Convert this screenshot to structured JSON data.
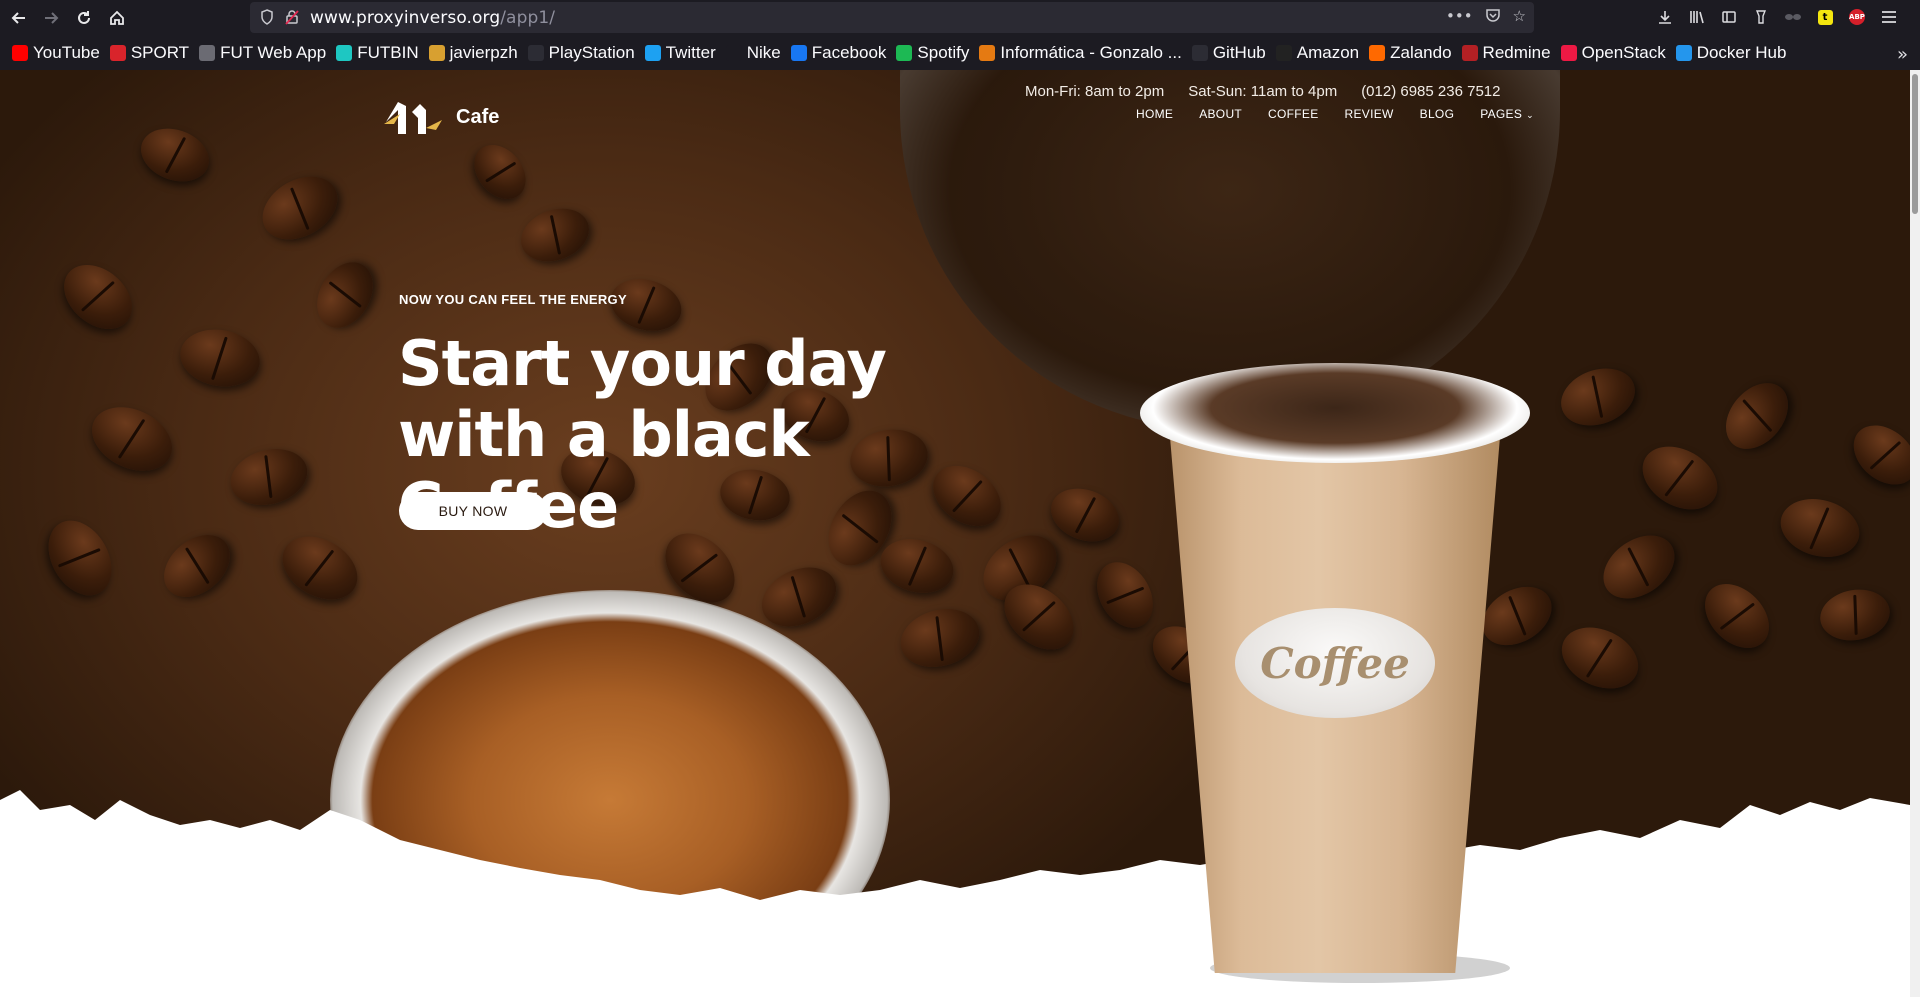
{
  "browser": {
    "url_host": "www.proxyinverso.org",
    "url_path": "/app1/",
    "bookmarks": [
      {
        "label": "YouTube",
        "color": "#ff0000"
      },
      {
        "label": "SPORT",
        "color": "#d9242b"
      },
      {
        "label": "FUT Web App",
        "color": "#6b6b73"
      },
      {
        "label": "FUTBIN",
        "color": "#1ec7c2"
      },
      {
        "label": "javierpzh",
        "color": "#d8a030"
      },
      {
        "label": "PlayStation",
        "color": "#2c2c34"
      },
      {
        "label": "Twitter",
        "color": "#1da1f2"
      },
      {
        "label": "Nike",
        "color": "#1c1b22"
      },
      {
        "label": "Facebook",
        "color": "#1877f2"
      },
      {
        "label": "Spotify",
        "color": "#1db954"
      },
      {
        "label": "Informática - Gonzalo ...",
        "color": "#e57a12"
      },
      {
        "label": "GitHub",
        "color": "#2c2c34"
      },
      {
        "label": "Amazon",
        "color": "#222222"
      },
      {
        "label": "Zalando",
        "color": "#ff6900"
      },
      {
        "label": "Redmine",
        "color": "#b32024"
      },
      {
        "label": "OpenStack",
        "color": "#ed1944"
      },
      {
        "label": "Docker Hub",
        "color": "#2496ed"
      }
    ]
  },
  "site": {
    "logo_text": "Cafe",
    "hours_weekday": "Mon-Fri: 8am to 2pm",
    "hours_weekend": "Sat-Sun: 11am to 4pm",
    "phone": "(012) 6985 236 7512",
    "nav": [
      "HOME",
      "ABOUT",
      "COFFEE",
      "REVIEW",
      "BLOG",
      "PAGES"
    ],
    "hero": {
      "eyebrow": "NOW YOU CAN FEEL THE ENERGY",
      "headline": "Start your day with a black Coffee",
      "cta": "BUY NOW",
      "cup_label": "Coffee"
    }
  }
}
